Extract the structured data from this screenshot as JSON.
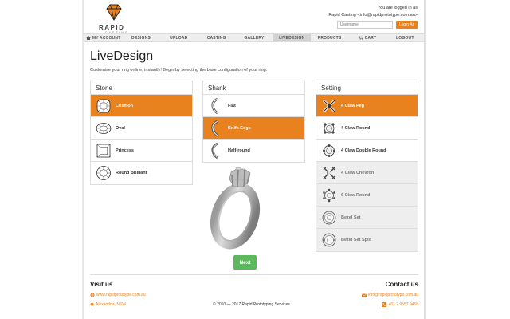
{
  "brand": {
    "name": "RAPID",
    "tagline": "CASTING"
  },
  "login": {
    "line1": "You are logged in as",
    "line2": "Rapid Casting <info@rapidprototype.com.au>",
    "username_placeholder": "Username",
    "button": "Login As"
  },
  "nav": [
    {
      "label": "MY ACCOUNT",
      "icon": "home-icon"
    },
    {
      "label": "DESIGNS"
    },
    {
      "label": "UPLOAD"
    },
    {
      "label": "CASTING"
    },
    {
      "label": "GALLERY"
    },
    {
      "label": "LIVEDESIGN",
      "active": true
    },
    {
      "label": "PRODUCTS"
    },
    {
      "label": "CART",
      "icon": "cart-icon"
    },
    {
      "label": "LOGOUT"
    }
  ],
  "page": {
    "title": "LiveDesign",
    "subtitle": "Customise your ring online, instantly! Begin by selecting the base configuration of your ring."
  },
  "stone": {
    "title": "Stone",
    "options": [
      "Cushion",
      "Oval",
      "Princess",
      "Round Brilliant"
    ],
    "selected": "Cushion"
  },
  "shank": {
    "title": "Shank",
    "options": [
      "Flat",
      "Knife Edge",
      "Half-round"
    ],
    "selected": "Knife Edge"
  },
  "setting": {
    "title": "Setting",
    "options": [
      "4 Claw Peg",
      "4 Claw Round",
      "4 Claw Double Round",
      "4 Claw Chevron",
      "6 Claw Round",
      "Bezel Set",
      "Bezel Set Split"
    ],
    "selected": "4 Claw Peg",
    "disabled": [
      "4 Claw Chevron",
      "6 Claw Round",
      "Bezel Set",
      "Bezel Set Split"
    ]
  },
  "next_button": "Next",
  "footer": {
    "visit_title": "Visit us",
    "website": "www.rapidprototype.com.au",
    "location": "Alexandria, NSW",
    "copyright": "© 2010 — 2017 Rapid Prototyping Services",
    "contact_title": "Contact us",
    "email": "info@rapidprototype.com.au",
    "phone": "+61 2 9557 9468"
  },
  "colors": {
    "accent": "#e8821f",
    "next": "#5cb85c",
    "disabled": "#eeeeee"
  }
}
